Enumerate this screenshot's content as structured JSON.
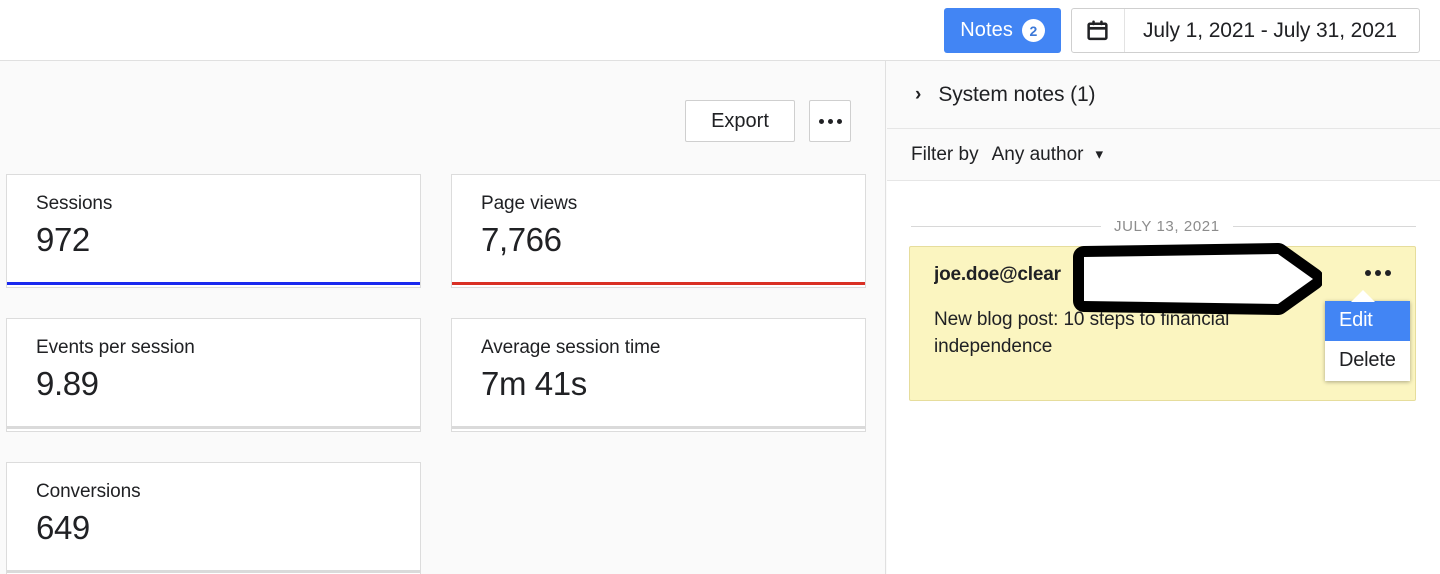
{
  "topbar": {
    "notes_button": {
      "label": "Notes",
      "badge": "2",
      "icon": "notes-icon",
      "color": "#4285f4"
    },
    "date_range": {
      "icon": "calendar-icon",
      "value": "July 1, 2021 - July 31, 2021"
    }
  },
  "main": {
    "actions": {
      "export_label": "Export",
      "more_icon": "ellipsis-icon"
    },
    "cards": [
      {
        "label": "Sessions",
        "value": "972",
        "accent": "#1a29ef"
      },
      {
        "label": "Page views",
        "value": "7,766",
        "accent": "#d93025"
      },
      {
        "label": "Events per session",
        "value": "9.89",
        "accent": "#dadada"
      },
      {
        "label": "Average session time",
        "value": "7m 41s",
        "accent": "#dadada"
      },
      {
        "label": "Conversions",
        "value": "649",
        "accent": "#dadada"
      }
    ]
  },
  "notes_panel": {
    "system_notes": {
      "chevron_icon": "chevron-right-icon",
      "label": "System notes (1)"
    },
    "filter": {
      "label": "Filter by",
      "value": "Any author",
      "chevron_icon": "chevron-down-icon"
    },
    "date_divider": "JULY 13, 2021",
    "note": {
      "author": "joe.doe@clear",
      "body": "New blog post: 10 steps to financial independence",
      "menu_icon": "ellipsis-icon",
      "background": "#fbf5c0"
    },
    "popup_menu": {
      "items": [
        {
          "label": "Edit",
          "active": true
        },
        {
          "label": "Delete",
          "active": false
        }
      ],
      "active_color": "#4285f4"
    }
  },
  "annotation": {
    "type": "hollow-right-arrow",
    "stroke": "#000000",
    "fill": "#ffffff"
  }
}
